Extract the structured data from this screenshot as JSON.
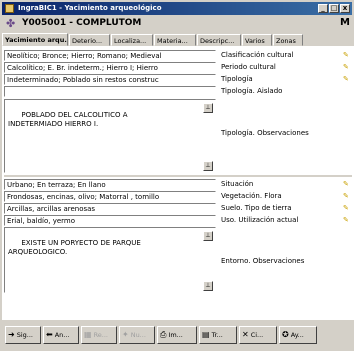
{
  "window": {
    "title": "IngraBIC1 - Yacimiento arqueológico",
    "controls": [
      "_",
      "□",
      "x"
    ]
  },
  "header": {
    "code": "Y005001",
    "separator": " - ",
    "name": "COMPLUTOM"
  },
  "tabs": [
    "Yacimiento arqu...",
    "Deterio...",
    "Localiza...",
    "Materia...",
    "Descripc...",
    "Varios",
    "Zonas"
  ],
  "fields": {
    "clasificacion_cultural": {
      "label": "Clasificación cultural",
      "value": "Neolítico; Bronce; Hierro; Romano; Medieval"
    },
    "periodo_cultural": {
      "label": "Periodo cultural",
      "value": "Calcolítico; E. Br. indeterm.; Hierro I; Hierro"
    },
    "tipologia": {
      "label": "Tipología",
      "value": "Indeterminado; Poblado sin restos construc"
    },
    "tipologia_aislado": {
      "label": "Tipología. Aislado",
      "value": ""
    },
    "tipologia_observaciones": {
      "label": "Tipología. Observaciones",
      "value": "POBLADO DEL CALCOLITICO A\nINDETERMIADO HIERRO I."
    },
    "situacion": {
      "label": "Situación",
      "value": "Urbano; En terraza; En llano"
    },
    "vegetacion_flora": {
      "label": "Vegetación. Flora",
      "value": "Frondosas, encinas, olivo; Matorral , tomillo"
    },
    "suelo_tipo_tierra": {
      "label": "Suelo. Tipo de tierra",
      "value": "Arcillas, arcillas arenosas"
    },
    "uso_utilizacion": {
      "label": "Uso. Utilización actual",
      "value": "Erial, baldío, yermo"
    },
    "entorno_observaciones": {
      "label": "Entorno. Observaciones",
      "value": "EXISTE UN PORYECTO DE PARQUE\nARQUEOLOGICO."
    }
  },
  "toolbar": [
    {
      "label": "Sig...",
      "icon": "arrow-right-icon",
      "enabled": true
    },
    {
      "label": "An...",
      "icon": "arrow-left-icon",
      "enabled": true
    },
    {
      "label": "Re...",
      "icon": "record-icon",
      "enabled": false
    },
    {
      "label": "Nu...",
      "icon": "new-icon",
      "enabled": false
    },
    {
      "label": "Im...",
      "icon": "print-icon",
      "enabled": true
    },
    {
      "label": "Tr...",
      "icon": "table-icon",
      "enabled": true
    },
    {
      "label": "Ci...",
      "icon": "close-icon",
      "enabled": true
    },
    {
      "label": "Ay...",
      "icon": "help-icon",
      "enabled": true
    }
  ],
  "colors": {
    "titlebar": "#0a246a",
    "face": "#d4d0c8",
    "pick_icon": "#c8a000"
  }
}
